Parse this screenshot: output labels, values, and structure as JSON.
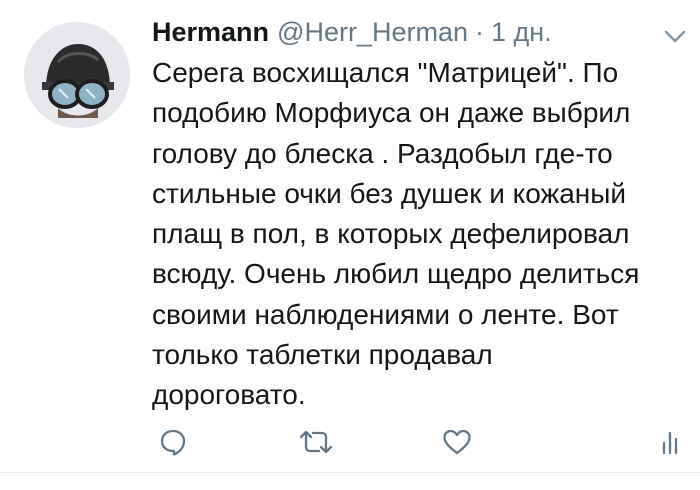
{
  "tweet": {
    "author": {
      "display_name": "Hermann",
      "handle": "@Herr_Herman",
      "separator": "·",
      "time": "1 дн."
    },
    "avatar_icon": "avatar-helmet-goggles-icon",
    "menu_icon": "chevron-down-icon",
    "body_lines": [
      "Серега восхищался \"Матрицей\". По",
      "подобию Морфиуса он даже выбрил",
      "голову до блеска . Раздобыл где-то",
      "стильные очки без душек и кожаный",
      "плащ в пол, в которых дефелировал",
      "всюду. Очень любил щедро делиться",
      "своими наблюдениями о ленте. Вот",
      "только таблетки продавал",
      "дороговато."
    ],
    "actions": {
      "reply_icon": "reply-icon",
      "retweet_icon": "retweet-icon",
      "like_icon": "heart-icon",
      "stats_icon": "analytics-icon"
    },
    "colors": {
      "text": "#14171a",
      "secondary": "#657786",
      "action": "#657786"
    }
  }
}
